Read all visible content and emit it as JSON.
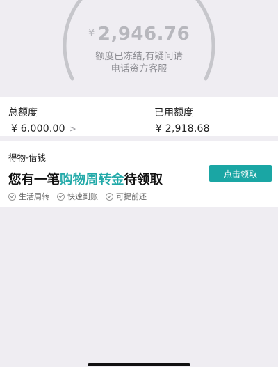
{
  "status": {
    "balance_currency": "¥",
    "balance": "2,946.76",
    "notice_line1": "额度已冻结,有疑问请",
    "notice_line2": "电话资方客服"
  },
  "credit": {
    "total_label": "总额度",
    "total_value": "¥ 6,000.00",
    "used_label": "已用额度",
    "used_value": "¥ 2,918.68"
  },
  "promo": {
    "brand": "得物·借钱",
    "headline_before": "您有一笔",
    "headline_highlight": "购物周转金",
    "headline_after": "待领取",
    "cta_label": "点击领取",
    "features": [
      "生活周转",
      "快速到账",
      "可提前还"
    ]
  },
  "colors": {
    "accent": "#1aa6a4",
    "background": "#efedf2",
    "gauge": "#c6c6cb"
  },
  "icons": {
    "chevron": "chevron-right-icon",
    "check": "check-circle-icon"
  }
}
